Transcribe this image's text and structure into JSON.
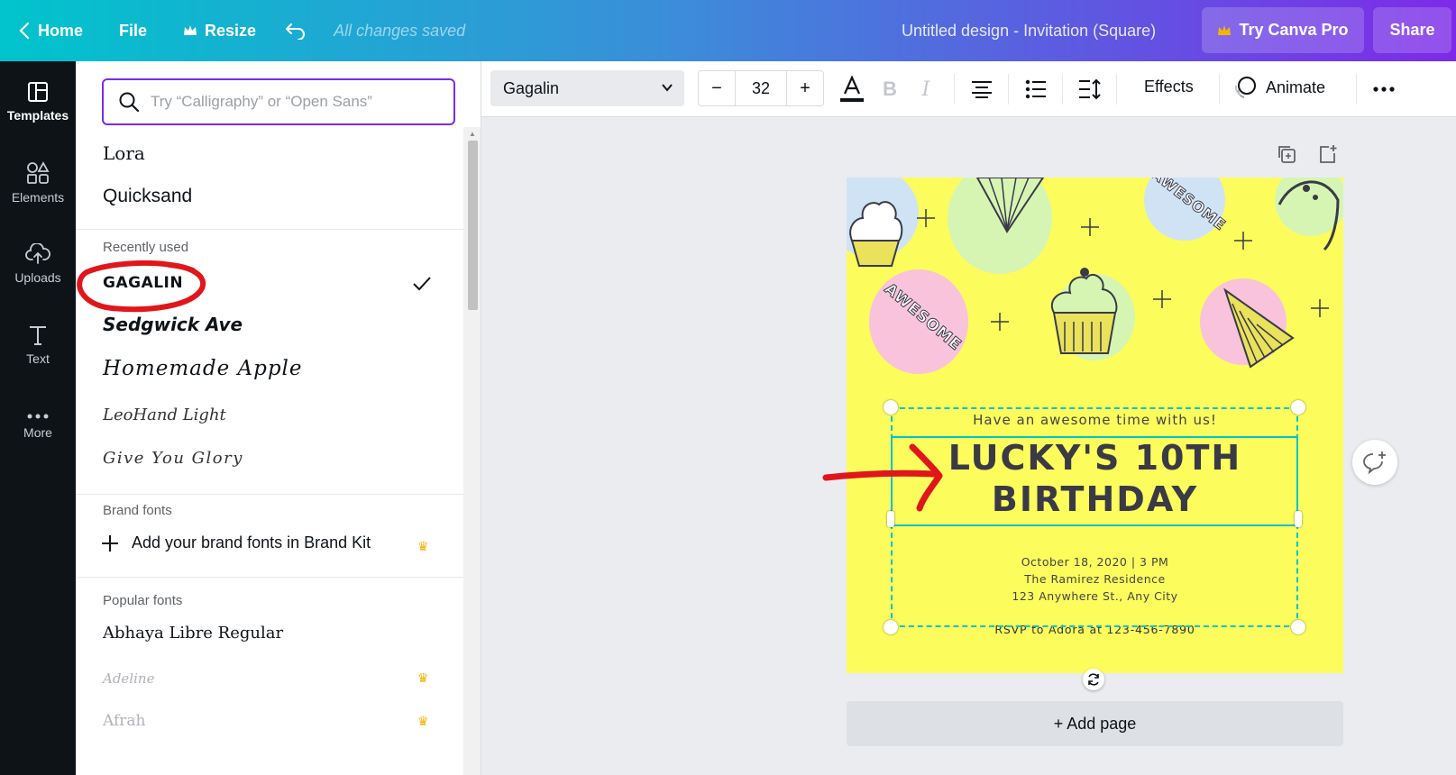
{
  "topbar": {
    "home": "Home",
    "file": "File",
    "resize": "Resize",
    "saved_status": "All changes saved",
    "doc_title": "Untitled design - Invitation (Square)",
    "try_pro": "Try Canva Pro",
    "share": "Share"
  },
  "rail": {
    "items": [
      {
        "label": "Templates",
        "icon": "templates-icon"
      },
      {
        "label": "Elements",
        "icon": "elements-icon"
      },
      {
        "label": "Uploads",
        "icon": "upload-cloud-icon"
      },
      {
        "label": "Text",
        "icon": "text-icon"
      },
      {
        "label": "More",
        "icon": "more-dots-icon"
      }
    ]
  },
  "font_panel": {
    "search_placeholder": "Try “Calligraphy” or “Open Sans”",
    "top_fonts": [
      "Lora",
      "Quicksand"
    ],
    "recently_used_label": "Recently used",
    "recently_used": [
      {
        "name": "GAGALIN",
        "selected": true
      },
      {
        "name": "Sedgwick Ave",
        "selected": false
      },
      {
        "name": "Homemade Apple",
        "selected": false
      },
      {
        "name": "LeoHand Light",
        "selected": false
      },
      {
        "name": "Give You Glory",
        "selected": false
      }
    ],
    "brand_fonts_label": "Brand fonts",
    "brand_fonts_add": "Add your brand fonts in Brand Kit",
    "popular_fonts_label": "Popular fonts",
    "popular_fonts": [
      {
        "name": "Abhaya Libre Regular",
        "pro": false
      },
      {
        "name": "Adeline",
        "pro": true
      },
      {
        "name": "Afrah",
        "pro": true
      }
    ]
  },
  "toolbar": {
    "font_name": "Gagalin",
    "font_size": "32",
    "minus": "−",
    "plus": "+",
    "effects": "Effects",
    "animate": "Animate"
  },
  "design": {
    "tagline": "Have an awesome time with us!",
    "title_line1": "LUCKY'S 10TH",
    "title_line2": "BIRTHDAY",
    "details": [
      "October 18, 2020 | 3 PM",
      "The Ramirez Residence",
      "123 Anywhere St., Any City"
    ],
    "rsvp": "RSVP to Adora at 123-456-7890",
    "sticker_text": "AWESOME",
    "background_color": "#fcfc5d"
  },
  "add_page": "+ Add page",
  "colors": {
    "accent": "#7d2ae8",
    "selection": "#00c4cc",
    "pro_crown": "#f4b400",
    "annotation_red": "#e0161b"
  }
}
